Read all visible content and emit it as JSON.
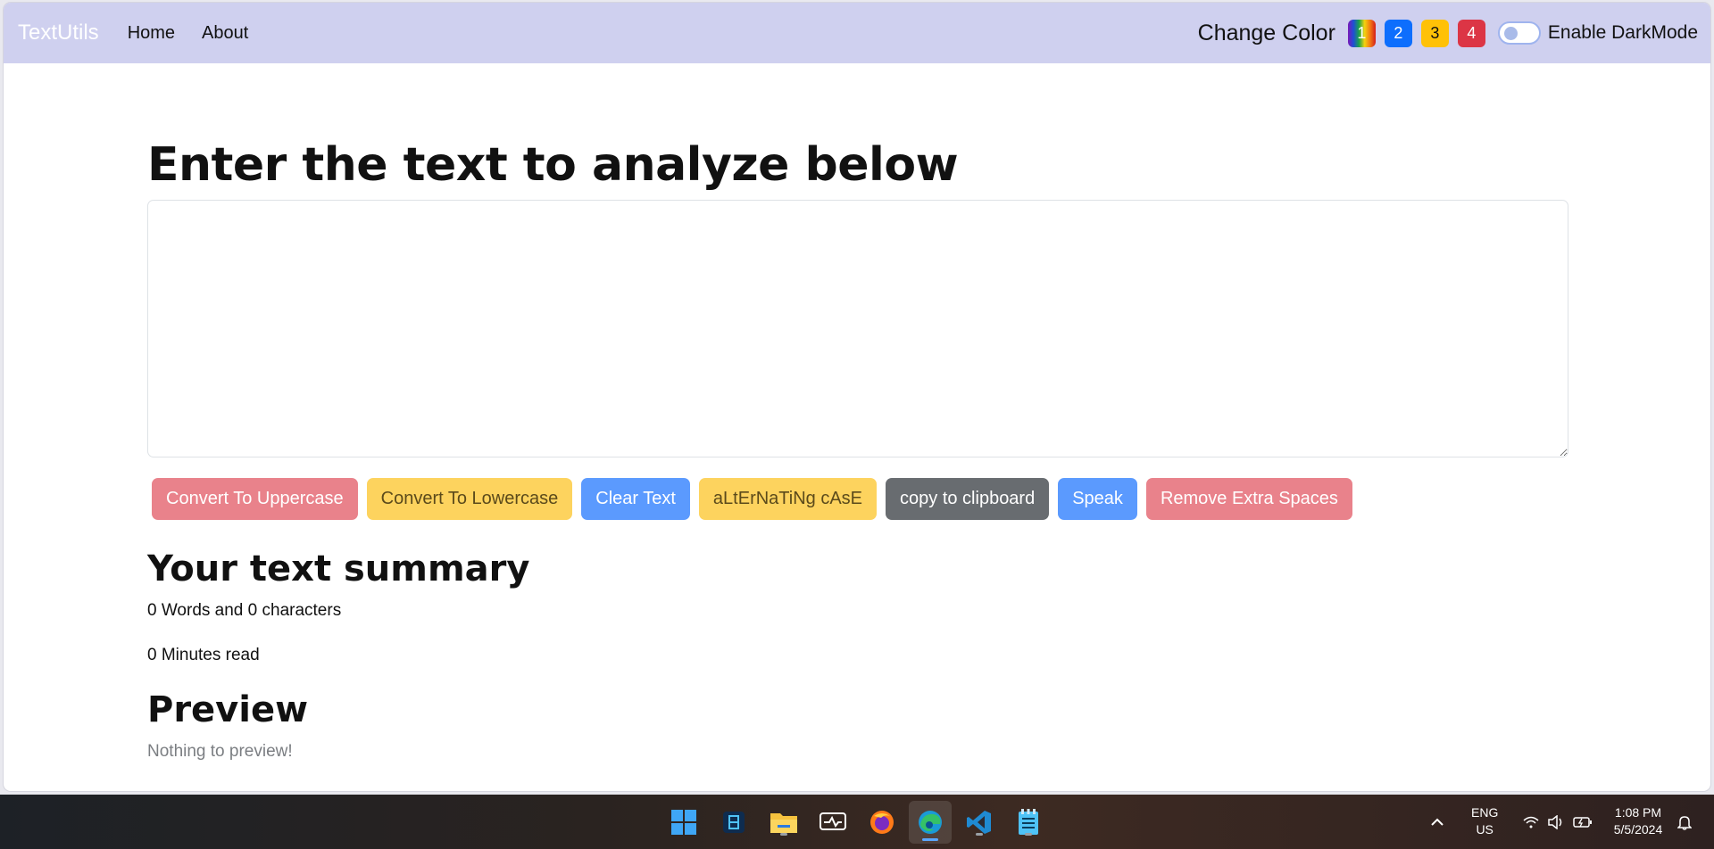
{
  "navbar": {
    "brand": "TextUtils",
    "links": [
      "Home",
      "About"
    ],
    "change_color_label": "Change Color",
    "swatches": [
      "1",
      "2",
      "3",
      "4"
    ],
    "darkmode_label": "Enable DarkMode"
  },
  "main": {
    "heading": "Enter the text to analyze below",
    "textarea_value": "",
    "buttons": [
      "Convert To Uppercase",
      "Convert To Lowercase",
      "Clear Text",
      "aLtErNaTiNg cAsE",
      "copy to clipboard",
      "Speak",
      "Remove Extra Spaces"
    ],
    "summary_heading": "Your text summary",
    "words_line": "0 Words and 0 characters",
    "minutes_line": "0 Minutes read",
    "preview_heading": "Preview",
    "preview_text": "Nothing to preview!"
  },
  "colors": {
    "navbar_bg": "#cfd0ef",
    "btn_red": "#e9828b",
    "btn_yellow": "#fdd35e",
    "btn_blue": "#5b9afe",
    "btn_gray": "#686c70"
  },
  "taskbar": {
    "icons": [
      "windows-start-icon",
      "app-icon",
      "file-explorer-icon",
      "monitor-icon",
      "firefox-icon",
      "edge-icon",
      "vscode-icon",
      "notepad-icon"
    ],
    "language_top": "ENG",
    "language_bottom": "US",
    "time": "1:08 PM",
    "date": "5/5/2024"
  }
}
